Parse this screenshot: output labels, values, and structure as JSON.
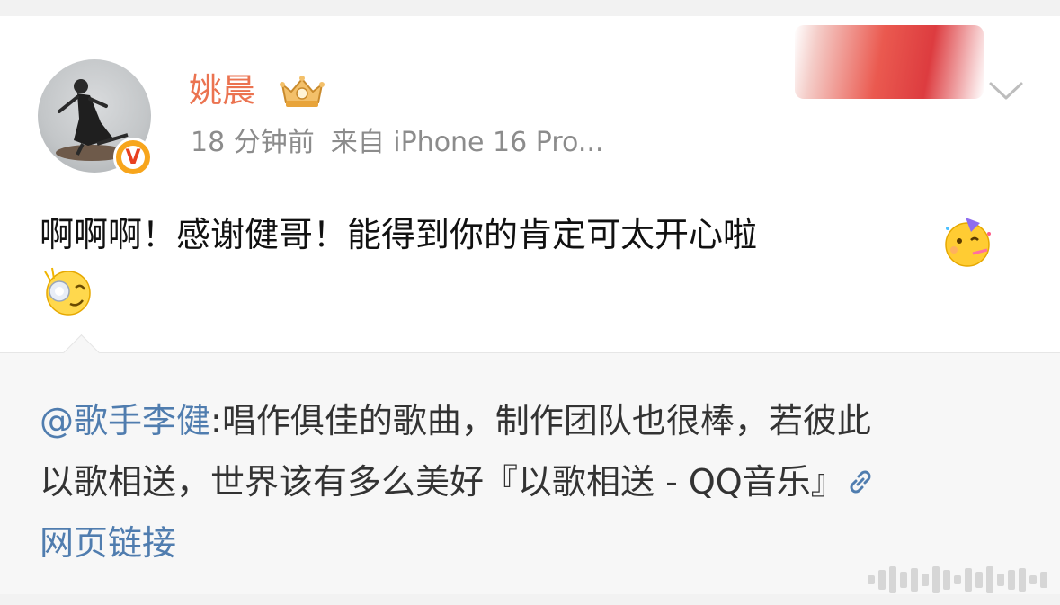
{
  "post": {
    "author": "姚晨",
    "time": "18 分钟前",
    "source": "来自 iPhone 16 Pro...",
    "text": "啊啊啊！感谢健哥！能得到你的肯定可太开心啦"
  },
  "repost": {
    "mention": "@歌手李健",
    "line1_rest": ":唱作俱佳的歌曲，制作团队也很棒，若彼此",
    "line2_text": "以歌相送，世界该有多么美好",
    "line2_link": "『以歌相送 - QQ音乐』",
    "line3_link": "网页链接"
  },
  "icons": {
    "crown": "vip-crown-icon",
    "verified": "verified-v-icon",
    "chevron": "chevron-down-icon",
    "emoji_party": "party-face-emoji",
    "emoji_laugh": "laughing-emoji",
    "link": "link-icon"
  },
  "colors": {
    "author": "#eb7350",
    "link": "#507daf",
    "meta": "#8c8c8c",
    "badge": "#f7a51c"
  }
}
